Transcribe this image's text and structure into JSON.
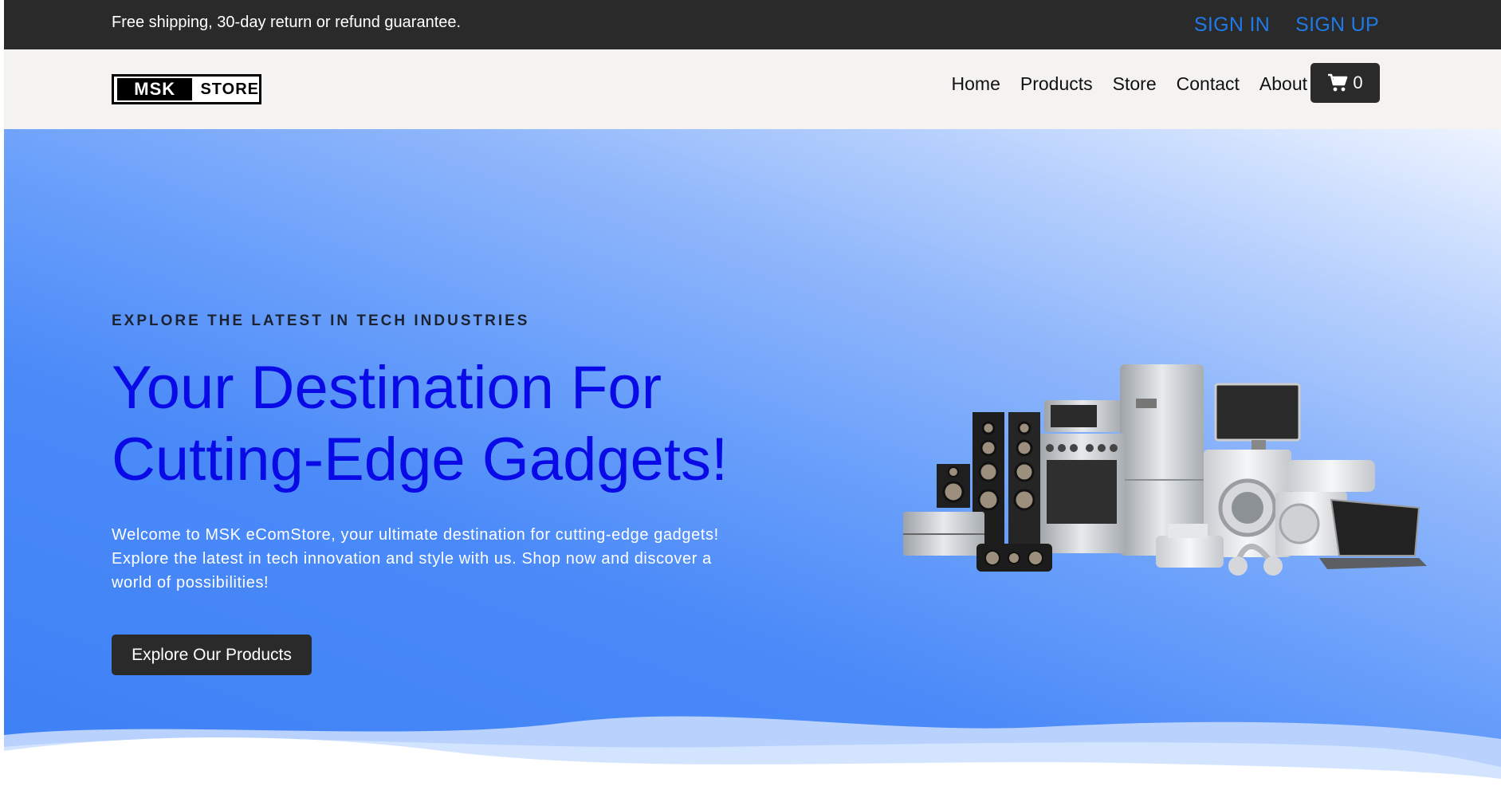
{
  "topbar": {
    "notice": "Free shipping, 30-day return or refund guarantee.",
    "sign_in": "SIGN IN",
    "sign_up": "SIGN UP"
  },
  "logo": {
    "left": "MSK",
    "right": "STORE"
  },
  "nav": {
    "items": [
      {
        "label": "Home"
      },
      {
        "label": "Products"
      },
      {
        "label": "Store"
      },
      {
        "label": "Contact"
      },
      {
        "label": "About"
      }
    ],
    "cart_icon": "cart-icon",
    "cart_count": "0"
  },
  "hero": {
    "eyebrow": "EXPLORE THE LATEST IN TECH INDUSTRIES",
    "headline_line1": "Your Destination For",
    "headline_line2": "Cutting-Edge Gadgets!",
    "lead": "Welcome to MSK eComStore, your ultimate destination for cutting-edge gadgets! Explore the latest in tech innovation and style with us. Shop now and discover a world of possibilities!",
    "cta": "Explore Our Products",
    "image_subject": "home-appliances-and-electronics"
  },
  "colors": {
    "topbar_bg": "#2b2a2a",
    "auth_link": "#1f7ae8",
    "navbar_bg": "#f4f3f2",
    "headline": "#0a0ae6",
    "hero_blue": "#3d80f6"
  }
}
